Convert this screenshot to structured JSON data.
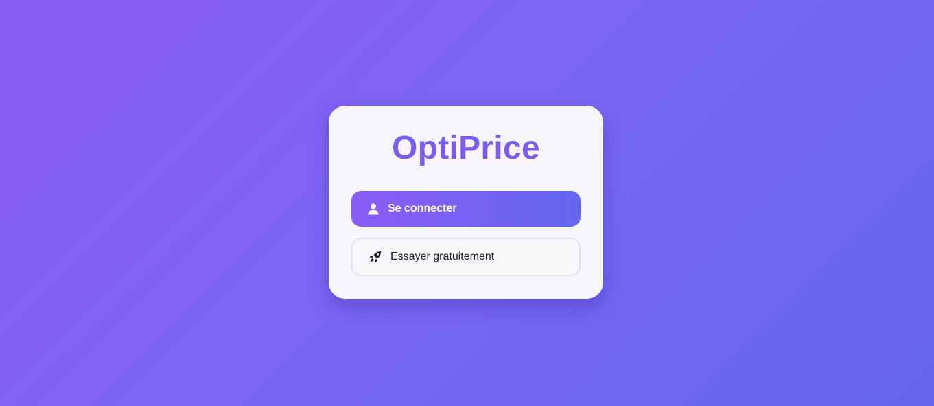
{
  "app": {
    "brand_name": "OptiPrice"
  },
  "actions": {
    "login": {
      "label": "Se connecter",
      "icon": "user-icon"
    },
    "trial": {
      "label": "Essayer gratuitement",
      "icon": "rocket-icon"
    }
  },
  "colors": {
    "background_start": "#8b5cf6",
    "background_end": "#6366f1",
    "brand": "#7a5ee9",
    "card": "#f6f5f9",
    "secondary_border": "#e3e3ea",
    "secondary_text": "#1b1b2b"
  }
}
